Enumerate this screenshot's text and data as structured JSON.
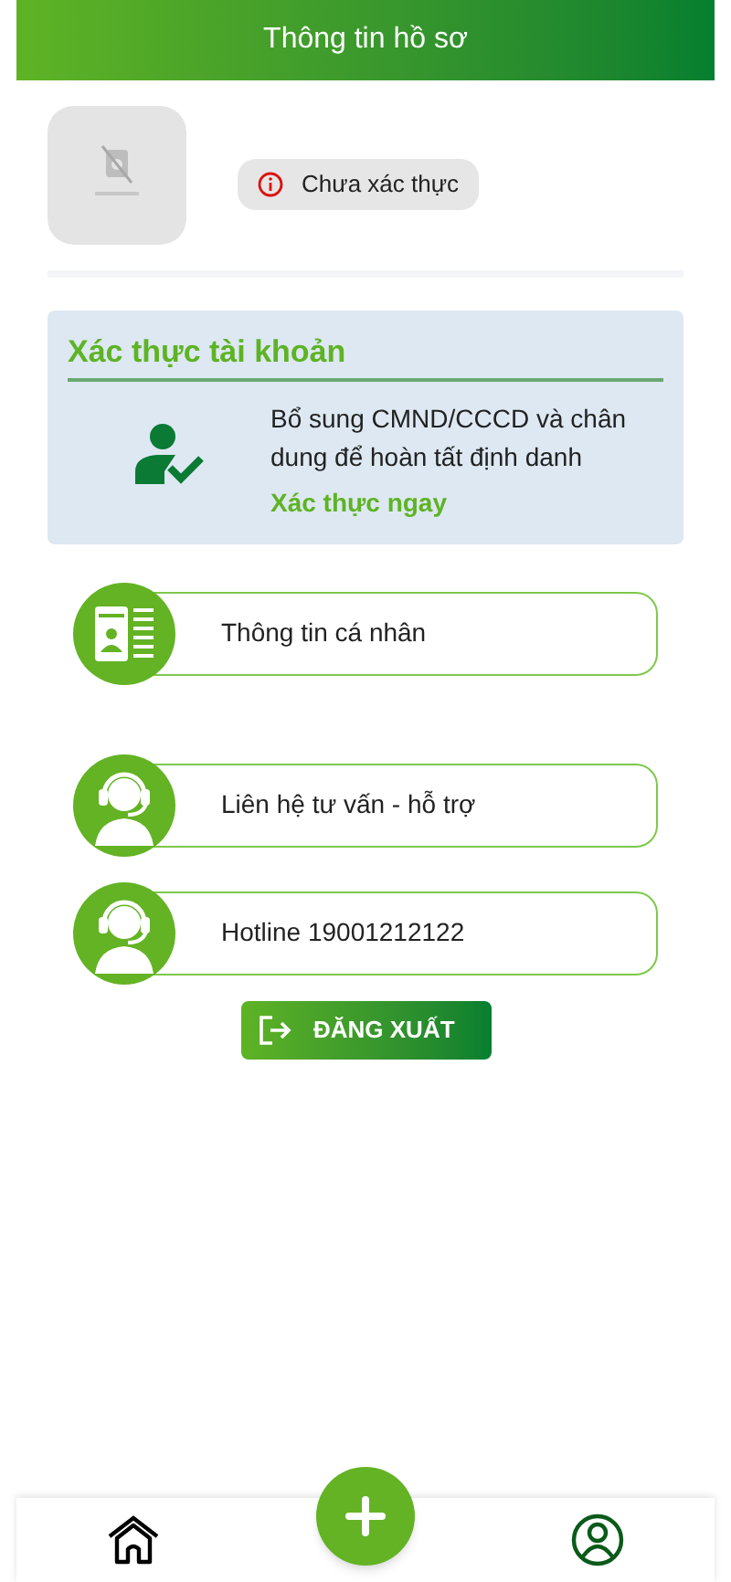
{
  "header": {
    "title": "Thông tin hồ sơ"
  },
  "profile": {
    "status": {
      "verified": false,
      "label": "Chưa xác thực"
    }
  },
  "verify_card": {
    "title": "Xác thực tài khoản",
    "description": "Bổ sung CMND/CCCD và chân dung để hoàn tất định danh",
    "link": "Xác thực ngay"
  },
  "menu": [
    {
      "kind": "id-card",
      "label": "Thông tin cá nhân"
    },
    {
      "kind": "headset",
      "label": "Liên hệ tư vấn - hỗ trợ"
    },
    {
      "kind": "headset",
      "label": "Hotline 19001212122"
    }
  ],
  "logout_button": {
    "label": "ĐĂNG XUẤT"
  },
  "bottom_nav": {
    "items": [
      {
        "kind": "home",
        "selected": false
      },
      {
        "kind": "add",
        "selected": false
      },
      {
        "kind": "profile",
        "selected": true
      }
    ]
  }
}
